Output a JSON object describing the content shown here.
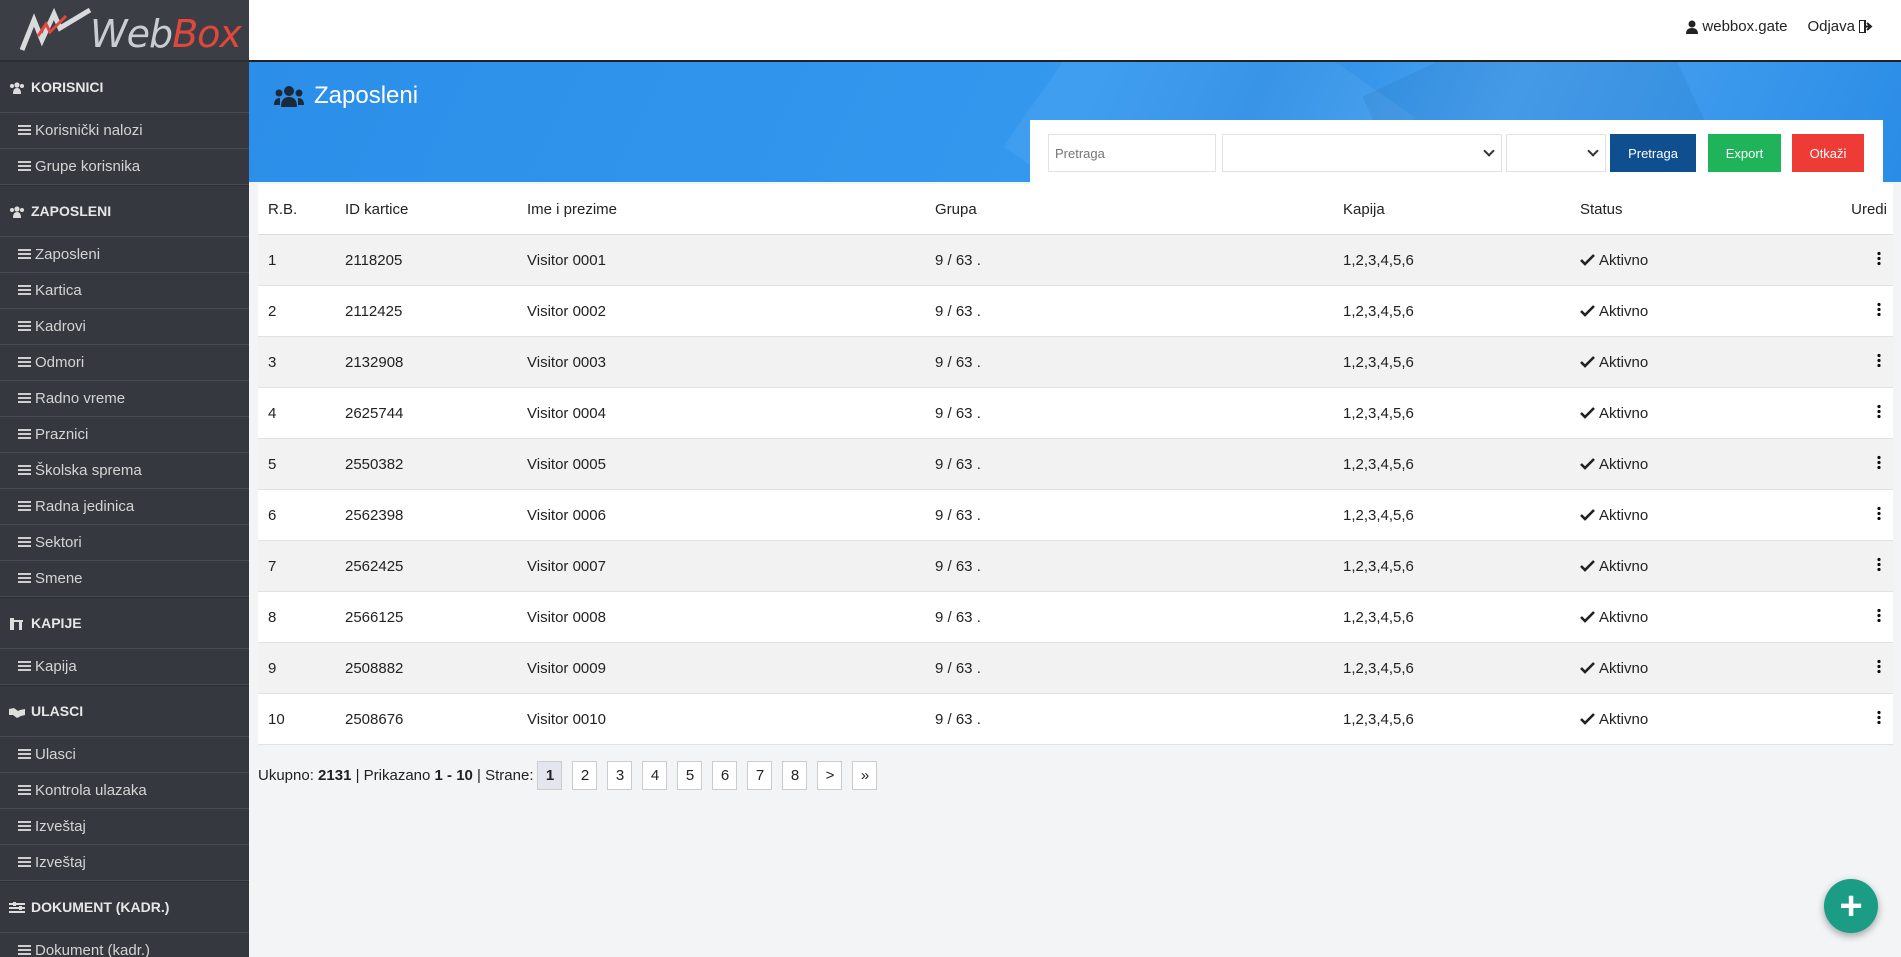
{
  "logo": {
    "web": "Web",
    "box": "Box"
  },
  "topbar": {
    "user": "webbox.gate",
    "logout": "Odjava"
  },
  "page": {
    "title": "Zaposleni"
  },
  "filter": {
    "search_placeholder": "Pretraga",
    "search_btn": "Pretraga",
    "export_btn": "Export",
    "cancel_btn": "Otkaži"
  },
  "colors": {
    "sidebar": "#35393f",
    "search_btn": "#0f4f8f",
    "export_btn": "#1fb35a",
    "cancel_btn": "#ef3b35",
    "fab": "#1a9c85"
  },
  "sidebar": {
    "sections": [
      {
        "title": "KORISNICI",
        "icon": "users-icon",
        "items": [
          "Korisnički nalozi",
          "Grupe korisnika"
        ]
      },
      {
        "title": "ZAPOSLENI",
        "icon": "users-icon",
        "items": [
          "Zaposleni",
          "Kartica",
          "Kadrovi",
          "Odmori",
          "Radno vreme",
          "Praznici",
          "Školska sprema",
          "Radna jedinica",
          "Sektori",
          "Smene"
        ]
      },
      {
        "title": "KAPIJE",
        "icon": "gate-icon",
        "items": [
          "Kapija"
        ]
      },
      {
        "title": "ULASCI",
        "icon": "handshake-icon",
        "items": [
          "Ulasci",
          "Kontrola ulazaka",
          "Izveštaj",
          "Izveštaj"
        ]
      },
      {
        "title": "DOKUMENT (KADR.)",
        "icon": "sliders-icon",
        "items": [
          "Dokument (kadr.)"
        ]
      }
    ]
  },
  "table": {
    "headers": [
      "R.B.",
      "ID kartice",
      "Ime i prezime",
      "Grupa",
      "Kapija",
      "Status",
      "Uredi"
    ],
    "rows": [
      [
        "1",
        "2118205",
        "Visitor 0001",
        "9 / 63 .",
        "1,2,3,4,5,6",
        "Aktivno"
      ],
      [
        "2",
        "2112425",
        "Visitor 0002",
        "9 / 63 .",
        "1,2,3,4,5,6",
        "Aktivno"
      ],
      [
        "3",
        "2132908",
        "Visitor 0003",
        "9 / 63 .",
        "1,2,3,4,5,6",
        "Aktivno"
      ],
      [
        "4",
        "2625744",
        "Visitor 0004",
        "9 / 63 .",
        "1,2,3,4,5,6",
        "Aktivno"
      ],
      [
        "5",
        "2550382",
        "Visitor 0005",
        "9 / 63 .",
        "1,2,3,4,5,6",
        "Aktivno"
      ],
      [
        "6",
        "2562398",
        "Visitor 0006",
        "9 / 63 .",
        "1,2,3,4,5,6",
        "Aktivno"
      ],
      [
        "7",
        "2562425",
        "Visitor 0007",
        "9 / 63 .",
        "1,2,3,4,5,6",
        "Aktivno"
      ],
      [
        "8",
        "2566125",
        "Visitor 0008",
        "9 / 63 .",
        "1,2,3,4,5,6",
        "Aktivno"
      ],
      [
        "9",
        "2508882",
        "Visitor 0009",
        "9 / 63 .",
        "1,2,3,4,5,6",
        "Aktivno"
      ],
      [
        "10",
        "2508676",
        "Visitor 0010",
        "9 / 63 .",
        "1,2,3,4,5,6",
        "Aktivno"
      ]
    ]
  },
  "pager": {
    "total_label": "Ukupno:",
    "total": "2131",
    "sep1": " | Prikazano ",
    "shown": "1 - 10",
    "sep2": " | Strane:",
    "pages": [
      "1",
      "2",
      "3",
      "4",
      "5",
      "6",
      "7",
      "8",
      ">",
      "»"
    ]
  },
  "fab": {
    "label": "+"
  }
}
